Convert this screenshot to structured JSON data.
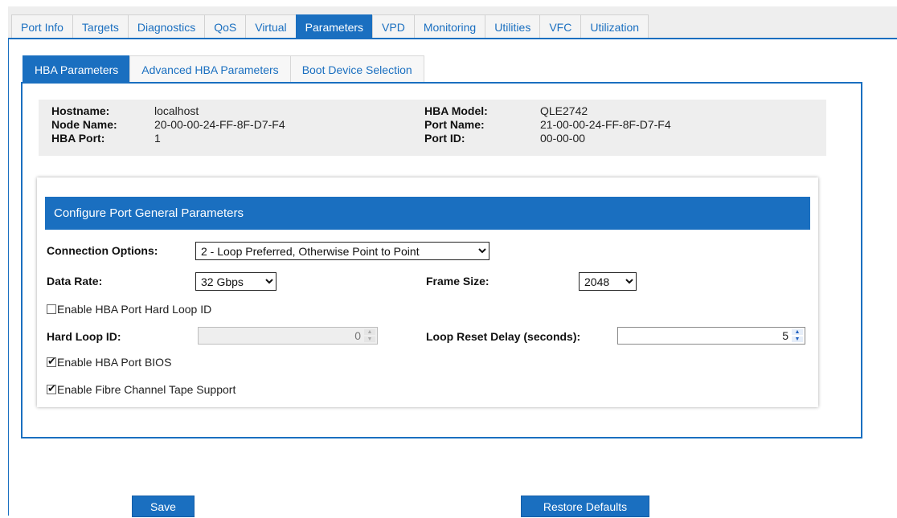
{
  "top_tabs": [
    {
      "label": "Port Info"
    },
    {
      "label": "Targets"
    },
    {
      "label": "Diagnostics"
    },
    {
      "label": "QoS"
    },
    {
      "label": "Virtual"
    },
    {
      "label": "Parameters"
    },
    {
      "label": "VPD"
    },
    {
      "label": "Monitoring"
    },
    {
      "label": "Utilities"
    },
    {
      "label": "VFC"
    },
    {
      "label": "Utilization"
    }
  ],
  "active_top_tab": "Parameters",
  "sub_tabs": [
    {
      "label": "HBA Parameters"
    },
    {
      "label": "Advanced HBA Parameters"
    },
    {
      "label": "Boot Device Selection"
    }
  ],
  "active_sub_tab": "HBA Parameters",
  "info": {
    "hostname_label": "Hostname:",
    "hostname": "localhost",
    "node_name_label": "Node Name:",
    "node_name": "20-00-00-24-FF-8F-D7-F4",
    "hba_port_label": "HBA Port:",
    "hba_port": "1",
    "hba_model_label": "HBA Model:",
    "hba_model": "QLE2742",
    "port_name_label": "Port Name:",
    "port_name": "21-00-00-24-FF-8F-D7-F4",
    "port_id_label": "Port ID:",
    "port_id": "00-00-00"
  },
  "config": {
    "header": "Configure Port General Parameters",
    "connection_options_label": "Connection Options:",
    "connection_options_value": "2 - Loop Preferred, Otherwise Point to Point",
    "data_rate_label": "Data Rate:",
    "data_rate_value": "32 Gbps",
    "frame_size_label": "Frame Size:",
    "frame_size_value": "2048",
    "enable_hard_loop_label": "Enable HBA Port Hard Loop ID",
    "enable_hard_loop_checked": false,
    "hard_loop_id_label": "Hard Loop ID:",
    "hard_loop_id_value": "0",
    "loop_reset_delay_label": "Loop Reset Delay (seconds):",
    "loop_reset_delay_value": "5",
    "enable_bios_label": "Enable HBA Port BIOS",
    "enable_bios_checked": true,
    "enable_tape_label": "Enable Fibre Channel Tape Support",
    "enable_tape_checked": true
  },
  "buttons": {
    "save": "Save",
    "restore": "Restore Defaults"
  },
  "colors": {
    "accent": "#1a6fc0",
    "info_bg": "#eeeeee"
  }
}
